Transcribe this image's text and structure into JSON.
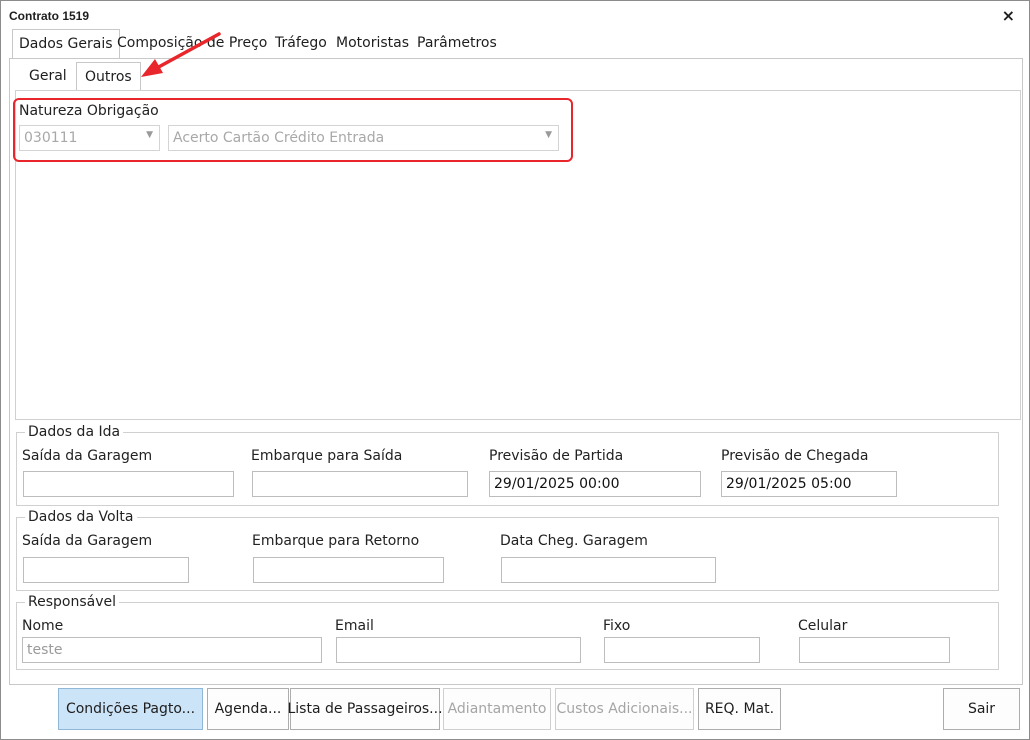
{
  "window": {
    "title": "Contrato 1519",
    "close_glyph": "×"
  },
  "tabs": [
    "Dados Gerais",
    "Composição de Preço",
    "Tráfego",
    "Motoristas",
    "Parâmetros"
  ],
  "subtabs": [
    "Geral",
    "Outros"
  ],
  "natureza": {
    "label": "Natureza Obrigação",
    "code": "030111",
    "description": "Acerto Cartão Crédito Entrada"
  },
  "ida": {
    "legend": "Dados da Ida",
    "saida_label": "Saída da Garagem",
    "saida_value": "",
    "embarque_label": "Embarque para Saída",
    "embarque_value": "",
    "partida_label": "Previsão de Partida",
    "partida_value": "29/01/2025 00:00",
    "chegada_label": "Previsão de Chegada",
    "chegada_value": "29/01/2025 05:00"
  },
  "volta": {
    "legend": "Dados da Volta",
    "saida_label": "Saída da Garagem",
    "saida_value": "",
    "embarque_label": "Embarque para Retorno",
    "embarque_value": "",
    "cheg_label": "Data Cheg. Garagem",
    "cheg_value": ""
  },
  "responsavel": {
    "legend": "Responsável",
    "nome_label": "Nome",
    "nome_value": "teste",
    "email_label": "Email",
    "email_value": "",
    "fixo_label": "Fixo",
    "fixo_value": "",
    "celular_label": "Celular",
    "celular_value": ""
  },
  "buttons": {
    "condicoes": "Condições Pagto...",
    "agenda": "Agenda...",
    "lista": "Lista de Passageiros...",
    "adiantamento": "Adiantamento",
    "custos": "Custos Adicionais...",
    "req": "REQ. Mat.",
    "sair": "Sair"
  },
  "colors": {
    "highlight": "#e8262b",
    "primary_button": "#cce4f7"
  }
}
